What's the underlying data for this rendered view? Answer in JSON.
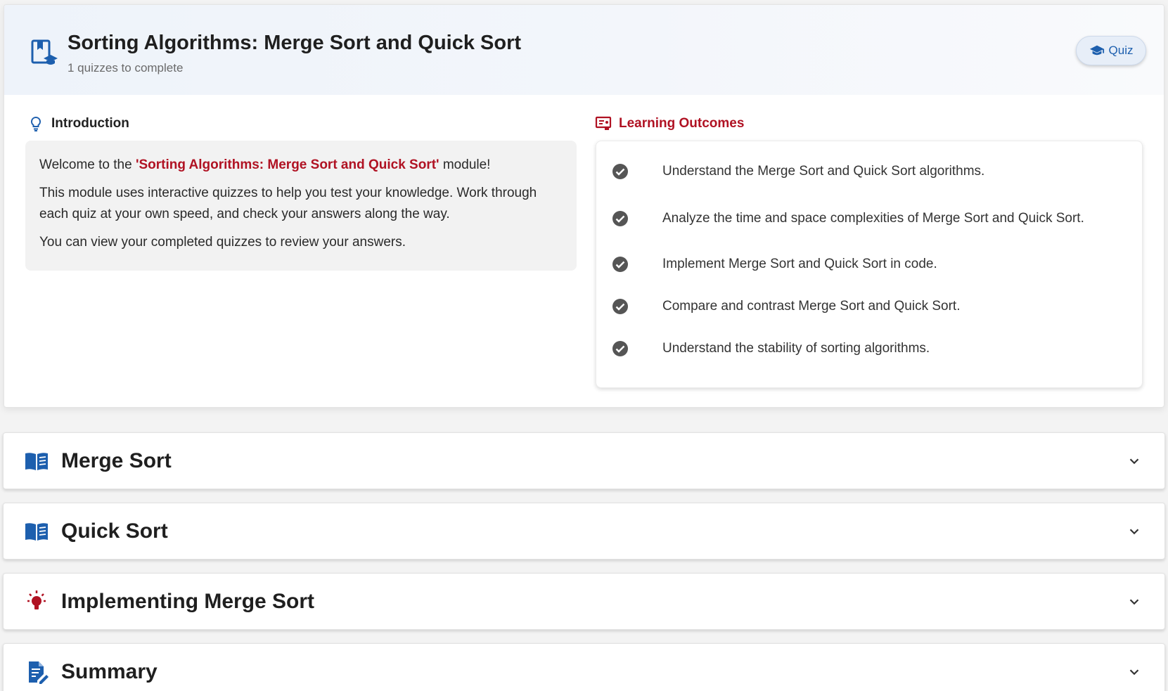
{
  "module": {
    "title": "Sorting Algorithms: Merge Sort and Quick Sort",
    "subtitle": "1 quizzes to complete",
    "icon": "book-bookmark-icon",
    "quiz_button": {
      "label": "Quiz",
      "icon": "graduation-cap-icon"
    }
  },
  "introduction": {
    "heading": "Introduction",
    "icon": "lightbulb-outline-icon",
    "welcome_prefix": "Welcome to the ",
    "welcome_highlight": "'Sorting Algorithms: Merge Sort and Quick Sort'",
    "welcome_suffix": " module!",
    "paragraph2": "This module uses interactive quizzes to help you test your knowledge. Work through each quiz at your own speed, and check your answers along the way.",
    "paragraph3": "You can view your completed quizzes to review your answers."
  },
  "learning_outcomes": {
    "heading": "Learning Outcomes",
    "icon": "presentation-board-icon",
    "items": [
      "Understand the Merge Sort and Quick Sort algorithms.",
      "Analyze the time and space complexities of Merge Sort and Quick Sort.",
      "Implement Merge Sort and Quick Sort in code.",
      "Compare and contrast Merge Sort and Quick Sort.",
      "Understand the stability of sorting algorithms."
    ]
  },
  "sections": [
    {
      "title": "Merge Sort",
      "icon": "open-book-icon"
    },
    {
      "title": "Quick Sort",
      "icon": "open-book-icon"
    },
    {
      "title": "Implementing Merge Sort",
      "icon": "lightbulb-icon"
    },
    {
      "title": "Summary",
      "icon": "document-edit-icon"
    }
  ],
  "colors": {
    "accent_red": "#b01223",
    "accent_blue": "#1d5fae",
    "check_gray": "#555555"
  }
}
